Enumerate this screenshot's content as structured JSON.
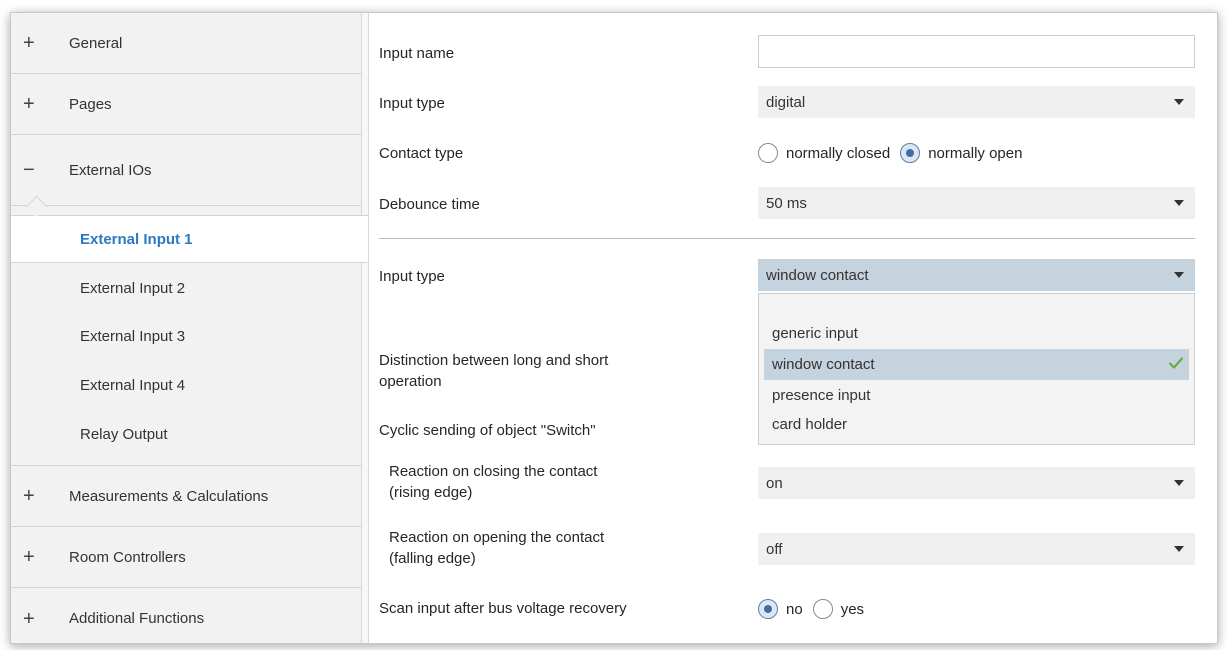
{
  "sidebar": {
    "groups": [
      {
        "sign": "+",
        "label": "General"
      },
      {
        "sign": "+",
        "label": "Pages"
      },
      {
        "sign": "−",
        "label": "External IOs"
      },
      {
        "sign": "+",
        "label": "Measurements & Calculations"
      },
      {
        "sign": "+",
        "label": "Room Controllers"
      },
      {
        "sign": "+",
        "label": "Additional Functions"
      }
    ],
    "sub_items": [
      {
        "label": "External Input 1"
      },
      {
        "label": "External Input 2"
      },
      {
        "label": "External Input 3"
      },
      {
        "label": "External Input 4"
      },
      {
        "label": "Relay Output"
      }
    ],
    "active_sub_item": "External Input 1",
    "active_color": "#2b79c2"
  },
  "main": {
    "input_name": {
      "label": "Input name",
      "value": ""
    },
    "input_type": {
      "label": "Input type",
      "value": "digital"
    },
    "contact_type": {
      "label": "Contact type",
      "option1": "normally closed",
      "option2": "normally open",
      "selected": "normally open"
    },
    "debounce": {
      "label": "Debounce time",
      "value": "50 ms"
    },
    "input_type2": {
      "label": "Input type",
      "value": "window contact",
      "options": [
        "generic input",
        "window contact",
        "presence input",
        "card holder"
      ],
      "selected": "window contact",
      "check_color": "#6aab3a"
    },
    "distinction": {
      "label_line1": "Distinction between long and short",
      "label_line2": "operation"
    },
    "cyclic": {
      "label": "Cyclic sending of object \"Switch\""
    },
    "reaction_close": {
      "label_line1": "Reaction on closing the contact",
      "label_line2": "(rising edge)",
      "value": "on"
    },
    "reaction_open": {
      "label_line1": "Reaction on opening the contact",
      "label_line2": "(falling edge)",
      "value": "off"
    },
    "scan": {
      "label": "Scan input after bus voltage recovery",
      "option1": "no",
      "option2": "yes",
      "selected": "no"
    }
  }
}
